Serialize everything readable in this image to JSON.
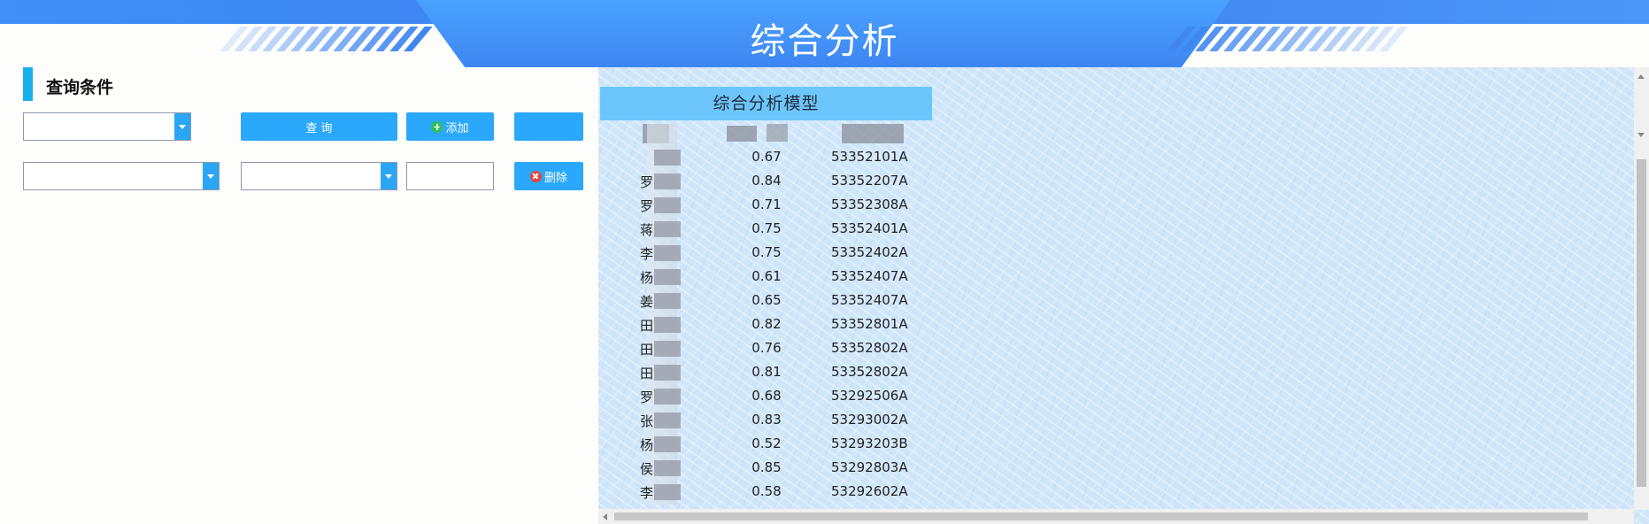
{
  "header": {
    "title": "综合分析",
    "accent_color": "#3e86f2"
  },
  "query_panel": {
    "section_title": "查询条件",
    "query_button": "查 询",
    "add_button": "添加",
    "delete_button": "删除",
    "blank_button": "",
    "selects": [
      {
        "value": ""
      },
      {
        "value": ""
      },
      {
        "value": ""
      }
    ],
    "text_input": {
      "value": "",
      "placeholder": ""
    }
  },
  "model_table": {
    "title": "综合分析模型",
    "rows": [
      {
        "name": "",
        "score": "0.67",
        "code": "53352101A"
      },
      {
        "name": "罗",
        "score": "0.84",
        "code": "53352207A"
      },
      {
        "name": "罗",
        "score": "0.71",
        "code": "53352308A"
      },
      {
        "name": "蒋",
        "score": "0.75",
        "code": "53352401A"
      },
      {
        "name": "李",
        "score": "0.75",
        "code": "53352402A"
      },
      {
        "name": "杨",
        "score": "0.61",
        "code": "53352407A"
      },
      {
        "name": "姜",
        "score": "0.65",
        "code": "53352407A"
      },
      {
        "name": "田",
        "score": "0.82",
        "code": "53352801A"
      },
      {
        "name": "田",
        "score": "0.76",
        "code": "53352802A"
      },
      {
        "name": "田",
        "score": "0.81",
        "code": "53352802A"
      },
      {
        "name": "罗",
        "score": "0.68",
        "code": "53292506A"
      },
      {
        "name": "张",
        "score": "0.83",
        "code": "53293002A"
      },
      {
        "name": "杨",
        "score": "0.52",
        "code": "53293203B"
      },
      {
        "name": "侯",
        "score": "0.85",
        "code": "53292803A"
      },
      {
        "name": "李",
        "score": "0.58",
        "code": "53292602A"
      }
    ]
  }
}
